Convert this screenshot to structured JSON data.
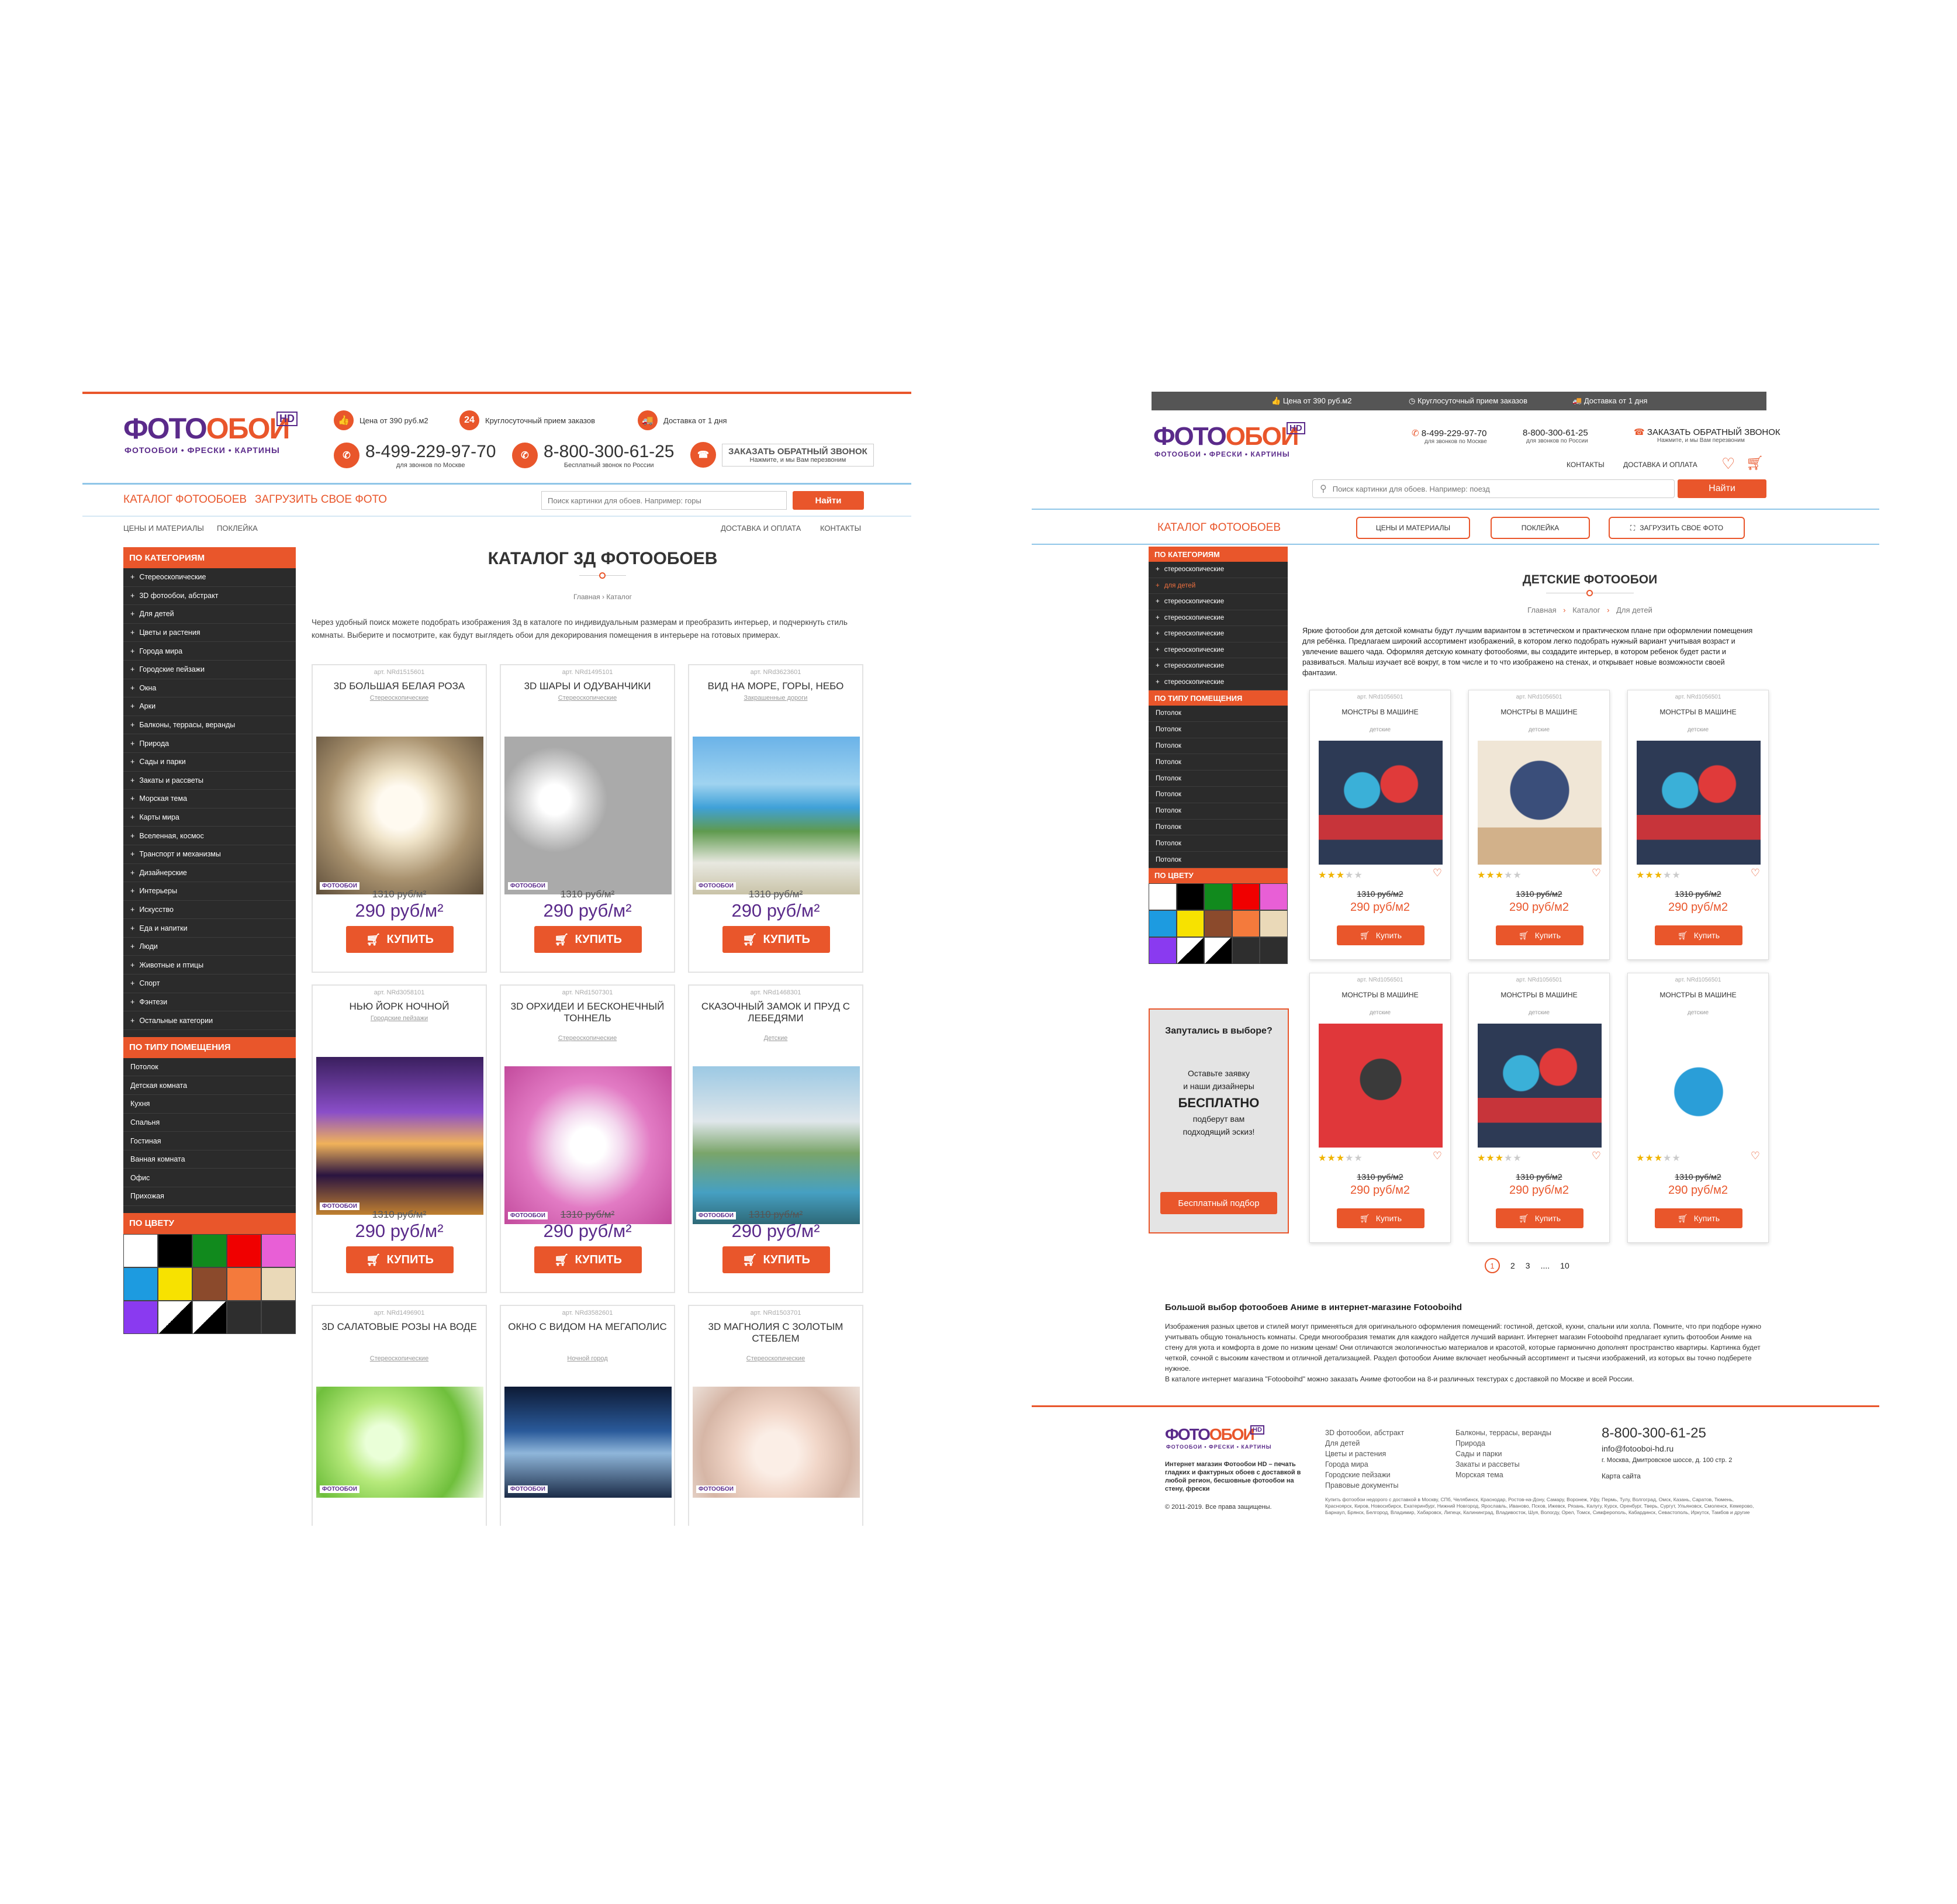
{
  "a": {
    "logo": {
      "part1": "ФОТО",
      "part2": "ОБОИ",
      "hd": "HD",
      "tag": "ФОТООБОИ • ФРЕСКИ • КАРТИНЫ"
    },
    "info": [
      "Цена от 390 руб.м2",
      "Круглосуточный прием заказов",
      "Доставка от 1 дня"
    ],
    "phone1": {
      "number": "8-499-229-97-70",
      "note": "для звонков по Москве"
    },
    "phone2": {
      "number": "8-800-300-61-25",
      "note": "Бесплатный звонок по России"
    },
    "callback": {
      "label": "ЗАКАЗАТЬ ОБРАТНЫЙ ЗВОНОК",
      "note": "Нажмите, и мы Вам перезвоним"
    },
    "nav": [
      "КАТАЛОГ ФОТООБОЕВ",
      "ЗАГРУЗИТЬ СВОЕ ФОТО"
    ],
    "search": {
      "placeholder": "Поиск картинки для обоев. Например: горы",
      "button": "Найти"
    },
    "subnav_left": [
      "ЦЕНЫ И МАТЕРИАЛЫ",
      "ПОКЛЕЙКА"
    ],
    "subnav_right": [
      "ДОСТАВКА И ОПЛАТА",
      "КОНТАКТЫ"
    ],
    "side_cat_title": "ПО КАТЕГОРИЯМ",
    "side_cats": [
      "Стереоскопические",
      "3D фотообои, абстракт",
      "Для детей",
      "Цветы и растения",
      "Города мира",
      "Городские пейзажи",
      "Окна",
      "Арки",
      "Балконы, террасы, веранды",
      "Природа",
      "Сады и парки",
      "Закаты и рассветы",
      "Морская тема",
      "Карты мира",
      "Вселенная, космос",
      "Транспорт и механизмы",
      "Дизайнерские",
      "Интерьеры",
      "Искусство",
      "Еда и напитки",
      "Люди",
      "Животные и птицы",
      "Спорт",
      "Фэнтези",
      "Остальные категории"
    ],
    "side_room_title": "ПО ТИПУ ПОМЕЩЕНИЯ",
    "side_rooms": [
      "Потолок",
      "Детская комната",
      "Кухня",
      "Спальня",
      "Гостиная",
      "Ванная комната",
      "Офис",
      "Прихожая"
    ],
    "side_color_title": "ПО ЦВЕТУ",
    "colors": [
      "#ffffff",
      "#000000",
      "#118a1d",
      "#f00000",
      "#e85fd6",
      "#1d9be0",
      "#f7e200",
      "#8b4a2c",
      "#f47a3c",
      "#ead9b8",
      "#8a3af0",
      "#bw",
      "#bw",
      "#2e2e2e",
      "#2e2e2e"
    ],
    "title": "КАТАЛОГ 3Д ФОТООБОЕВ",
    "crumbs": [
      "Главная",
      "Каталог"
    ],
    "crumb_sep": "›",
    "desc": "Через удобный поиск можете подобрать изображения 3д в каталоге по индивидуальным размерам и преобразить интерьер, и подчеркнуть стиль комнаты. Выберите и посмотрите, как будут выглядеть обои для декорирования помещения в интерьере на готовых примерах.",
    "products": [
      {
        "art": "арт. NRd1515601",
        "name": "3D БОЛЬШАЯ БЕЛАЯ РОЗА",
        "sub": "Стереоскопические",
        "old": "1310 руб/м²",
        "new": "290 руб/м²",
        "buy": "КУПИТЬ"
      },
      {
        "art": "арт. NRd1495101",
        "name": "3D ШАРЫ И ОДУВАНЧИКИ",
        "sub": "Стереоскопические",
        "old": "1310 руб/м²",
        "new": "290 руб/м²",
        "buy": "КУПИТЬ"
      },
      {
        "art": "арт. NRd3623601",
        "name": "ВИД НА МОРЕ, ГОРЫ, НЕБО",
        "sub": "Закрашенные дороги",
        "old": "1310 руб/м²",
        "new": "290 руб/м²",
        "buy": "КУПИТЬ"
      },
      {
        "art": "арт. NRd3058101",
        "name": "НЬЮ ЙОРК НОЧНОЙ",
        "sub": "Городские пейзажи",
        "old": "1310 руб/м²",
        "new": "290 руб/м²",
        "buy": "КУПИТЬ"
      },
      {
        "art": "арт. NRd1507301",
        "name": "3D ОРХИДЕИ И БЕСКОНЕЧНЫЙ ТОННЕЛЬ",
        "sub": "Стереоскопические",
        "old": "1310 руб/м²",
        "new": "290 руб/м²",
        "buy": "КУПИТЬ"
      },
      {
        "art": "арт. NRd1468301",
        "name": "СКАЗОЧНЫЙ ЗАМОК И ПРУД С ЛЕБЕДЯМИ",
        "sub": "Детские",
        "old": "1310 руб/м²",
        "new": "290 руб/м²",
        "buy": "КУПИТЬ"
      },
      {
        "art": "арт. NRd1496901",
        "name": "3D САЛАТОВЫЕ РОЗЫ НА ВОДЕ",
        "sub": "Стереоскопические",
        "old": "",
        "new": "",
        "buy": ""
      },
      {
        "art": "арт. NRd3582601",
        "name": "ОКНО С ВИДОМ НА МЕГАПОЛИС",
        "sub": "Ночной город",
        "old": "",
        "new": "",
        "buy": ""
      },
      {
        "art": "арт. NRd1503701",
        "name": "3D МАГНОЛИЯ С ЗОЛОТЫМ СТЕБЛЕМ",
        "sub": "Стереоскопические",
        "old": "",
        "new": "",
        "buy": ""
      }
    ]
  },
  "b": {
    "topbar": [
      "Цена от 390 руб.м2",
      "Круглосуточный прием заказов",
      "Доставка от 1 дня"
    ],
    "logo": {
      "part1": "ФОТО",
      "part2": "ОБОИ",
      "hd": "HD",
      "tag": "ФОТООБОИ • ФРЕСКИ • КАРТИНЫ"
    },
    "phone1": {
      "number": "8-499-229-97-70",
      "note": "для звонков по Москве"
    },
    "phone2": {
      "number": "8-800-300-61-25",
      "note": "для звонков по России"
    },
    "callback": {
      "label": "ЗАКАЗАТЬ ОБРАТНЫЙ ЗВОНОК",
      "note": "Нажмите, и мы Вам перезвоним"
    },
    "links": [
      "КОНТАКТЫ",
      "ДОСТАВКА И ОПЛАТА"
    ],
    "search": {
      "placeholder": "Поиск картинки для обоев. Например: поезд",
      "button": "Найти"
    },
    "nav": {
      "catalog": "КАТАЛОГ ФОТООБОЕВ",
      "b1": "ЦЕНЫ И МАТЕРИАЛЫ",
      "b2": "ПОКЛЕЙКА",
      "b3": "ЗАГРУЗИТЬ СВОЕ ФОТО"
    },
    "side_cat_title": "ПО КАТЕГОРИЯМ",
    "side_cats": [
      "стереоскопические",
      "для детей",
      "стереоскопические",
      "стереоскопические",
      "стереоскопические",
      "стереоскопические",
      "стереоскопические",
      "стереоскопические"
    ],
    "side_room_title": "ПО ТИПУ ПОМЕЩЕНИЯ",
    "side_rooms": [
      "Потолок",
      "Потолок",
      "Потолок",
      "Потолок",
      "Потолок",
      "Потолок",
      "Потолок",
      "Потолок",
      "Потолок",
      "Потолок"
    ],
    "side_color_title": "ПО ЦВЕТУ",
    "colors": [
      "#ffffff",
      "#000000",
      "#118a1d",
      "#f00000",
      "#e85fd6",
      "#1d9be0",
      "#f7e200",
      "#8b4a2c",
      "#f47a3c",
      "#ead9b8",
      "#8a3af0",
      "#bw",
      "#bw",
      "#2e2e2e",
      "#2e2e2e"
    ],
    "promo": {
      "q": "Запутались в выборе?",
      "l1": "Оставьте заявку",
      "l2": "и наши дизайнеры",
      "l3": "БЕСПЛАТНО",
      "l4": "подберут вам",
      "l5": "подходящий эскиз!",
      "btn": "Бесплатный подбор"
    },
    "title": "ДЕТСКИЕ ФОТООБОИ",
    "crumbs": [
      "Главная",
      "Каталог",
      "Для детей"
    ],
    "crumb_sep": "›",
    "desc": "Яркие фотообои для детской комнаты будут лучшим вариантом в эстетическом и практическом плане при оформлении помещения для ребёнка. Предлагаем широкий ассортимент изображений, в котором легко подобрать нужный вариант учитывая возраст и увлечение вашего чада. Оформляя детскую комнату фотообоями, вы создадите интерьер, в котором ребенок будет расти и развиваться. Малыш изучает всё вокруг, в том числе и то что изображено на стенах, и открывает новые возможности своей фантазии.",
    "products": [
      {
        "art": "арт. NRd1056501",
        "name": "МОНСТРЫ В МАШИНЕ",
        "sub": "детские",
        "old": "1310 руб/м2",
        "new": "290 руб/м2",
        "buy": "Купить",
        "rating": 3
      },
      {
        "art": "арт. NRd1056501",
        "name": "МОНСТРЫ В МАШИНЕ",
        "sub": "детские",
        "old": "1310 руб/м2",
        "new": "290 руб/м2",
        "buy": "Купить",
        "rating": 3
      },
      {
        "art": "арт. NRd1056501",
        "name": "МОНСТРЫ В МАШИНЕ",
        "sub": "детские",
        "old": "1310 руб/м2",
        "new": "290 руб/м2",
        "buy": "Купить",
        "rating": 3
      },
      {
        "art": "арт. NRd1056501",
        "name": "МОНСТРЫ В МАШИНЕ",
        "sub": "детские",
        "old": "1310 руб/м2",
        "new": "290 руб/м2",
        "buy": "Купить",
        "rating": 3
      },
      {
        "art": "арт. NRd1056501",
        "name": "МОНСТРЫ В МАШИНЕ",
        "sub": "детские",
        "old": "1310 руб/м2",
        "new": "290 руб/м2",
        "buy": "Купить",
        "rating": 3
      },
      {
        "art": "арт. NRd1056501",
        "name": "МОНСТРЫ В МАШИНЕ",
        "sub": "детские",
        "old": "1310 руб/м2",
        "new": "290 руб/м2",
        "buy": "Купить",
        "rating": 3
      }
    ],
    "pages": [
      "1",
      "2",
      "3",
      "....",
      "10"
    ],
    "seo_title": "Большой выбор фотообоев Аниме в интернет-магазине Fotooboihd",
    "seo_p1": "Изображения разных цветов и стилей могут применяться для оригинального оформления помещений: гостиной, детской, кухни, спальни или холла. Помните, что при подборе нужно учитывать общую тональность комнаты. Среди многообразия тематик для каждого найдется лучший вариант. Интернет магазин Fotooboihd предлагает купить фотообои Аниме на стену для уюта и комфорта в доме по низким ценам! Они отличаются экологичностью материалов и красотой, которые гармонично дополнят пространство квартиры. Картинка будет четкой, сочной с высоким качеством и отличной детализацией. Раздел фотообои Аниме включает необычный ассортимент и тысячи изображений, из которых вы точно подберете нужное.",
    "seo_p2": "В каталоге интернет магазина \"Fotooboihd\" можно заказать Аниме фотообои на 8-и различных текстурах с доставкой по Москве и всей России.",
    "footer": {
      "about": "Интернет магазин Фотообои HD – печать гладких и фактурных обоев с доставкой в любой регион, бесшовные фотообои на стену, фрески",
      "copy": "© 2011-2019. Все права защищены.",
      "col1": [
        "3D фотообои, абстракт",
        "Для детей",
        "Цветы и растения",
        "Города мира",
        "Городские пейзажи",
        "Правовые документы"
      ],
      "col2": [
        "Балконы, террасы, веранды",
        "Природа",
        "Сады и парки",
        "Закаты и рассветы",
        "Морская тема"
      ],
      "phone": "8-800-300-61-25",
      "email": "info@fotooboi-hd.ru",
      "address": "г. Москва, Дмитровское шоссе, д. 100 стр. 2",
      "sitemap": "Карта сайта",
      "cities": "Купить фотообои недорого с доставкой в Москву, СПб, Челябинск, Краснодар, Ростов-на-Дону, Самару, Воронеж, Уфу, Пермь, Тулу, Волгоград, Омск, Казань, Саратов, Тюмень, Красноярск, Киров, Новосибирск, Екатеринбург, Нижний Новгород, Ярославль, Иваново, Псков, Ижевск, Рязань, Калугу, Курск, Оренбург, Тверь, Сургут, Ульяновск, Смоленск, Кемерово, Барнаул, Брянск, Белгород, Владимир, Хабаровск, Липецк, Калининград, Владивосток, Шуя, Вологду, Орел, Томск, Симферополь, Кабардинск, Севастополь, Иркутск, Тамбов и другие"
    }
  }
}
